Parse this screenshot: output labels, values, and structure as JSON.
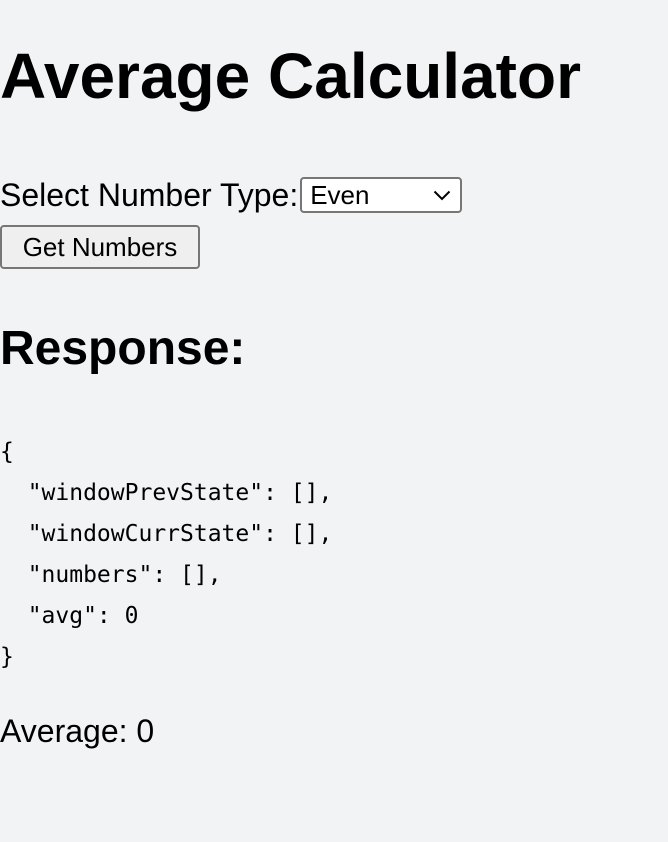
{
  "page": {
    "title": "Average Calculator"
  },
  "form": {
    "select_label": "Select Number Type:",
    "selected_option": "Even",
    "button_label": "Get Numbers"
  },
  "response": {
    "heading": "Response:",
    "json_text": "{\n  \"windowPrevState\": [],\n  \"windowCurrState\": [],\n  \"numbers\": [],\n  \"avg\": 0\n}",
    "values": {
      "windowPrevState": [],
      "windowCurrState": [],
      "numbers": [],
      "avg": 0
    }
  },
  "result": {
    "average_text": "Average: 0"
  },
  "icons": {
    "select_chevron": "chevron-down-icon"
  },
  "colors": {
    "background": "#f2f3f5",
    "text": "#000000",
    "control_border": "#767676",
    "button_bg": "#efefef",
    "select_bg": "#ffffff"
  }
}
